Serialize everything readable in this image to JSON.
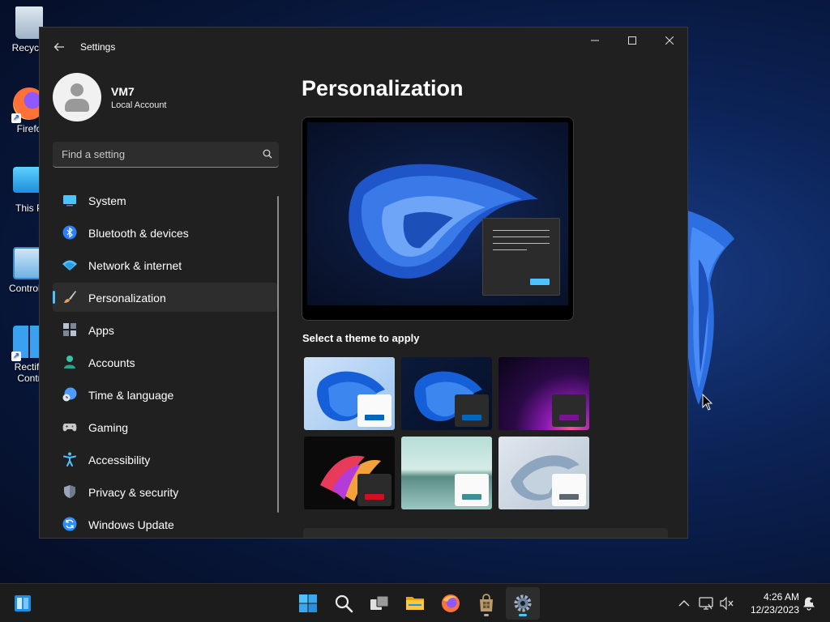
{
  "desktop": {
    "icons": [
      {
        "label": "Recycle",
        "icon": "recycle-bin-icon"
      },
      {
        "label": "Firefo",
        "icon": "firefox-icon"
      },
      {
        "label": "This P",
        "icon": "this-pc-icon"
      },
      {
        "label": "Control P",
        "icon": "control-panel-icon"
      },
      {
        "label": "Rectify",
        "label2": "Contr",
        "icon": "rectify11-icon"
      }
    ]
  },
  "window": {
    "title": "Settings",
    "back_icon": "back-arrow-icon",
    "controls": {
      "minimize": "minimize-icon",
      "maximize": "maximize-icon",
      "close": "close-icon"
    }
  },
  "profile": {
    "name": "VM7",
    "account_type": "Local Account"
  },
  "search": {
    "placeholder": "Find a setting",
    "value": ""
  },
  "nav": {
    "items": [
      {
        "label": "System",
        "icon": "system-icon",
        "color": "#4cc2ff"
      },
      {
        "label": "Bluetooth & devices",
        "icon": "bluetooth-icon",
        "color": "#2b7fff"
      },
      {
        "label": "Network & internet",
        "icon": "wifi-icon",
        "color": "#4cc2ff"
      },
      {
        "label": "Personalization",
        "icon": "paintbrush-icon",
        "color": "#e8a258",
        "active": true
      },
      {
        "label": "Apps",
        "icon": "apps-icon",
        "color": "#9aa6b8"
      },
      {
        "label": "Accounts",
        "icon": "accounts-icon",
        "color": "#3bc3a5"
      },
      {
        "label": "Time & language",
        "icon": "time-language-icon",
        "color": "#4c9bff"
      },
      {
        "label": "Gaming",
        "icon": "gaming-icon",
        "color": "#c8c8c8"
      },
      {
        "label": "Accessibility",
        "icon": "accessibility-icon",
        "color": "#4cc2ff"
      },
      {
        "label": "Privacy & security",
        "icon": "shield-icon",
        "color": "#9aa6b8"
      },
      {
        "label": "Windows Update",
        "icon": "windows-update-icon",
        "color": "#2b8fff"
      }
    ]
  },
  "main": {
    "title": "Personalization",
    "theme_section_label": "Select a theme to apply",
    "themes": [
      {
        "name": "light-bloom-theme",
        "accent": "#0067c0"
      },
      {
        "name": "dark-bloom-theme",
        "accent": "#0067c0"
      },
      {
        "name": "glow-theme",
        "accent": "#7a1296"
      },
      {
        "name": "captured-motion-theme",
        "accent": "#d10f1f"
      },
      {
        "name": "sunrise-theme",
        "accent": "#3f8e97"
      },
      {
        "name": "flow-theme",
        "accent": "#5c6670"
      }
    ]
  },
  "taskbar": {
    "widgets_icon": "widgets-icon",
    "apps": [
      "start-icon",
      "search-icon",
      "task-view-icon",
      "file-explorer-icon",
      "firefox-icon",
      "store-icon",
      "settings-icon"
    ],
    "tray": [
      "chevron-up-icon",
      "network-icon",
      "volume-muted-icon",
      "notification-icon"
    ],
    "time": "4:26 AM",
    "date": "12/23/2023"
  },
  "colors": {
    "accent": "#4cc2ff",
    "window_bg": "#202020",
    "taskbar_bg": "#1c1c1c"
  }
}
